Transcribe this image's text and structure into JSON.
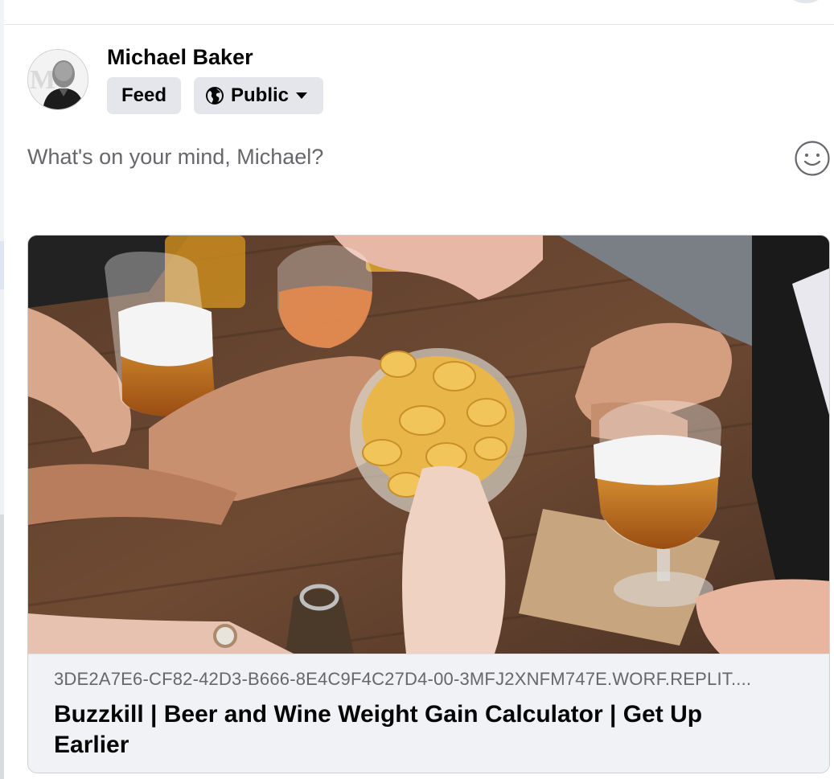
{
  "composer": {
    "author_name": "Michael Baker",
    "audience_feed_label": "Feed",
    "audience_privacy_label": "Public",
    "placeholder": "What's on your mind, Michael?"
  },
  "link_preview": {
    "domain": "3DE2A7E6-CF82-42D3-B666-8E4C9F4C27D4-00-3MFJ2XNFM747E.WORF.REPLIT....",
    "title": "Buzzkill | Beer and Wine Weight Gain Calculator | Get Up Earlier"
  },
  "icons": {
    "privacy": "globe-icon",
    "dropdown": "caret-down-icon",
    "emoji": "smiley-icon"
  },
  "colors": {
    "pill_background": "#e4e6eb",
    "secondary_text": "#65676b",
    "primary_text": "#050505",
    "card_footer": "#f0f2f5"
  }
}
